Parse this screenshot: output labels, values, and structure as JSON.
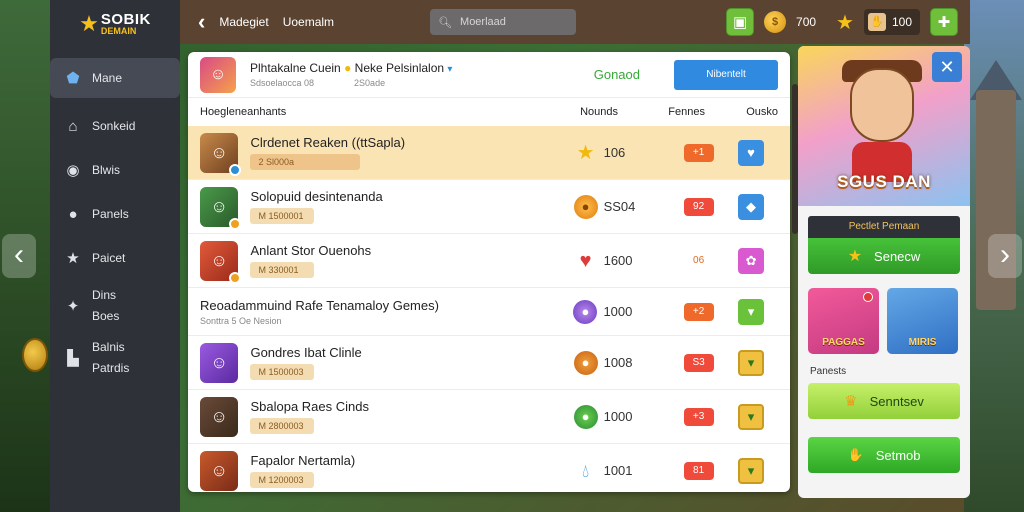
{
  "colors": {
    "sidebar_bg": "#2e3138",
    "topbar_bg": "#5a4330",
    "accent_blue": "#2f8ae0",
    "accent_green": "#37a83a",
    "highlight_row": "#fbe4b4"
  },
  "logo": {
    "main": "SOBIK",
    "sub": "DEMAIN"
  },
  "sidebar": {
    "items": [
      {
        "label": "Mane",
        "icon": "home-icon"
      },
      {
        "label": "Sonkeid",
        "icon": "building-icon"
      },
      {
        "label": "Blwis",
        "icon": "compass-icon"
      },
      {
        "label": "Panels",
        "icon": "chat-icon"
      },
      {
        "label": "Paicet",
        "icon": "star-icon"
      },
      {
        "label": "Dins",
        "label2": "Boes",
        "icon": "wrench-icon"
      },
      {
        "label": "Balnis",
        "label2": "Patrdis",
        "icon": "shop-icon"
      }
    ]
  },
  "topbar": {
    "breadcrumb_1": "Madegiet",
    "breadcrumb_2": "Uoemalm",
    "search_value": "Moerlaad",
    "coins": "700",
    "pill_value": "100"
  },
  "panel": {
    "header_title": "Plhtakalne Cuein",
    "header_title_2": "Neke Pelsinlalon",
    "header_sub_1": "Sdsoelaocca 08",
    "header_sub_2": "2S0ade",
    "status": "Gonaod",
    "action_button": "Nibentelt",
    "columns": [
      "Hoegleneanhants",
      "Nounds",
      "Fennes",
      "Ousko"
    ],
    "rows": [
      {
        "title": "Clrdenet Reaken ((ttSapla)",
        "tag": "2 Sl000a",
        "reward": "106",
        "reward_icon": "star-icon",
        "badge": "+1",
        "check_icon": "heart-icon",
        "highlight": true
      },
      {
        "title": "Solopuid desintenanda",
        "tag": "M 1500001",
        "reward": "SS04",
        "reward_icon": "coin-icon",
        "badge": "92",
        "check_icon": "diamond-icon"
      },
      {
        "title": "Anlant Stor Ouenohs",
        "tag": "M 330001",
        "reward": "1600",
        "reward_icon": "heart-icon",
        "badge": "06",
        "check_icon": "gem-icon"
      },
      {
        "title": "Gondres Ibat Clinle",
        "tag": "M 1500003",
        "reward": "1008",
        "reward_icon": "pumpkin-icon",
        "badge": "S3",
        "check_icon": "chevron-down-icon"
      },
      {
        "title": "Sbalopa Raes Cinds",
        "tag": "M 2800003",
        "reward": "1000",
        "reward_icon": "gem-icon",
        "badge": "+3",
        "check_icon": "chevron-down-icon"
      },
      {
        "title": "Fapalor Nertamla)",
        "tag": "M 1200003",
        "reward": "1001",
        "reward_icon": "drop-icon",
        "badge": "81",
        "check_icon": "chevron-down-icon"
      }
    ],
    "section_row": {
      "title": "Reoadammuind Rafe Tenamaloy Gemes)",
      "sub": "Sonttra 5 Oe Nesion",
      "reward": "1000",
      "badge": "+2"
    }
  },
  "right_panel": {
    "hero_title": "SGUS DAN",
    "promo_label": "Pectlet Pemaan",
    "promo_button": "Senecw",
    "card_a_label": "PAGGAS",
    "card_b_label": "MIRIS",
    "section_label": "Panests",
    "lime_button": "Senntsev",
    "green_button": "Setmob"
  }
}
